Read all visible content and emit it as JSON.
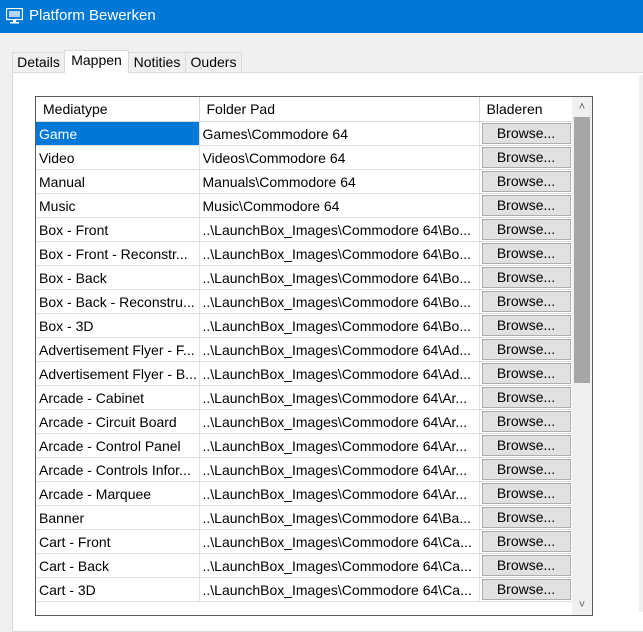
{
  "window": {
    "title": "Platform Bewerken",
    "icon": "monitor-icon"
  },
  "tabs": [
    {
      "label": "Details",
      "active": false
    },
    {
      "label": "Mappen",
      "active": true
    },
    {
      "label": "Notities",
      "active": false
    },
    {
      "label": "Ouders",
      "active": false
    }
  ],
  "grid": {
    "columns": [
      "Mediatype",
      "Folder Pad",
      "Bladeren"
    ],
    "button_label": "Browse...",
    "rows": [
      {
        "media": "Game",
        "path": "Games\\Commodore 64",
        "selected": true
      },
      {
        "media": "Video",
        "path": "Videos\\Commodore 64"
      },
      {
        "media": "Manual",
        "path": "Manuals\\Commodore 64"
      },
      {
        "media": "Music",
        "path": "Music\\Commodore 64"
      },
      {
        "media": "Box - Front",
        "path": "..\\LaunchBox_Images\\Commodore 64\\Bo..."
      },
      {
        "media": "Box - Front - Reconstr...",
        "path": "..\\LaunchBox_Images\\Commodore 64\\Bo..."
      },
      {
        "media": "Box - Back",
        "path": "..\\LaunchBox_Images\\Commodore 64\\Bo..."
      },
      {
        "media": "Box - Back - Reconstru...",
        "path": "..\\LaunchBox_Images\\Commodore 64\\Bo..."
      },
      {
        "media": "Box - 3D",
        "path": "..\\LaunchBox_Images\\Commodore 64\\Bo..."
      },
      {
        "media": "Advertisement Flyer - F...",
        "path": "..\\LaunchBox_Images\\Commodore 64\\Ad..."
      },
      {
        "media": "Advertisement Flyer - B...",
        "path": "..\\LaunchBox_Images\\Commodore 64\\Ad..."
      },
      {
        "media": "Arcade - Cabinet",
        "path": "..\\LaunchBox_Images\\Commodore 64\\Ar..."
      },
      {
        "media": "Arcade - Circuit Board",
        "path": "..\\LaunchBox_Images\\Commodore 64\\Ar..."
      },
      {
        "media": "Arcade - Control Panel",
        "path": "..\\LaunchBox_Images\\Commodore 64\\Ar..."
      },
      {
        "media": "Arcade - Controls Infor...",
        "path": "..\\LaunchBox_Images\\Commodore 64\\Ar..."
      },
      {
        "media": "Arcade - Marquee",
        "path": "..\\LaunchBox_Images\\Commodore 64\\Ar..."
      },
      {
        "media": "Banner",
        "path": "..\\LaunchBox_Images\\Commodore 64\\Ba..."
      },
      {
        "media": "Cart - Front",
        "path": "..\\LaunchBox_Images\\Commodore 64\\Ca..."
      },
      {
        "media": "Cart - Back",
        "path": "..\\LaunchBox_Images\\Commodore 64\\Ca..."
      },
      {
        "media": "Cart - 3D",
        "path": "..\\LaunchBox_Images\\Commodore 64\\Ca..."
      }
    ]
  },
  "scrollbar": {
    "up_icon": "chevron-up-icon",
    "down_icon": "chevron-down-icon",
    "position": 0
  },
  "colors": {
    "titlebar": "#0078d7",
    "selection": "#0078d7",
    "button": "#e1e1e1"
  }
}
